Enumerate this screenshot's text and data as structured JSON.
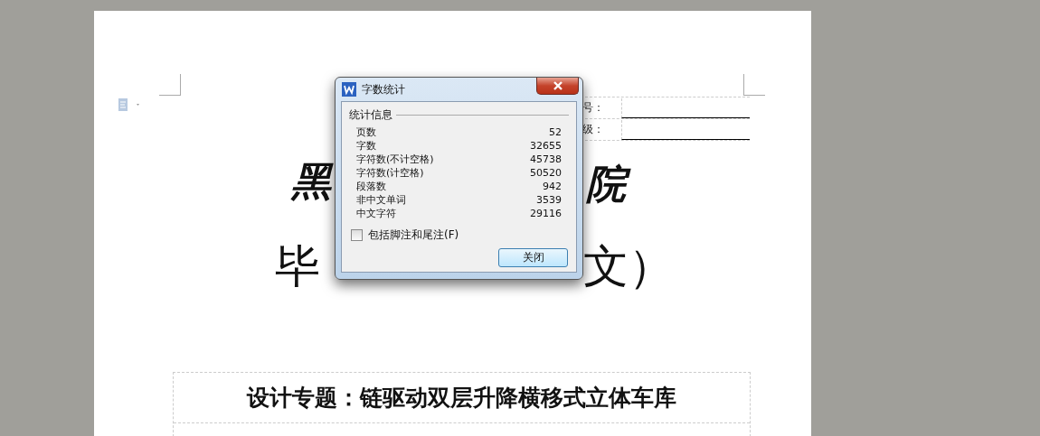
{
  "document": {
    "header_labels": [
      "号：",
      "级："
    ],
    "calligraphy": [
      "黑",
      "院"
    ],
    "title_parts": [
      "毕",
      "文）"
    ],
    "topic": "设计专题：链驱动双层升降横移式立体车库"
  },
  "dialog": {
    "title": "字数统计",
    "group": "统计信息",
    "stats": [
      {
        "label": "页数",
        "value": "52"
      },
      {
        "label": "字数",
        "value": "32655"
      },
      {
        "label": "字符数(不计空格)",
        "value": "45738"
      },
      {
        "label": "字符数(计空格)",
        "value": "50520"
      },
      {
        "label": "段落数",
        "value": "942"
      },
      {
        "label": "非中文单词",
        "value": "3539"
      },
      {
        "label": "中文字符",
        "value": "29116"
      }
    ],
    "checkbox": {
      "label": "包括脚注和尾注(F)",
      "checked": false
    },
    "buttons": [
      "关闭"
    ]
  }
}
